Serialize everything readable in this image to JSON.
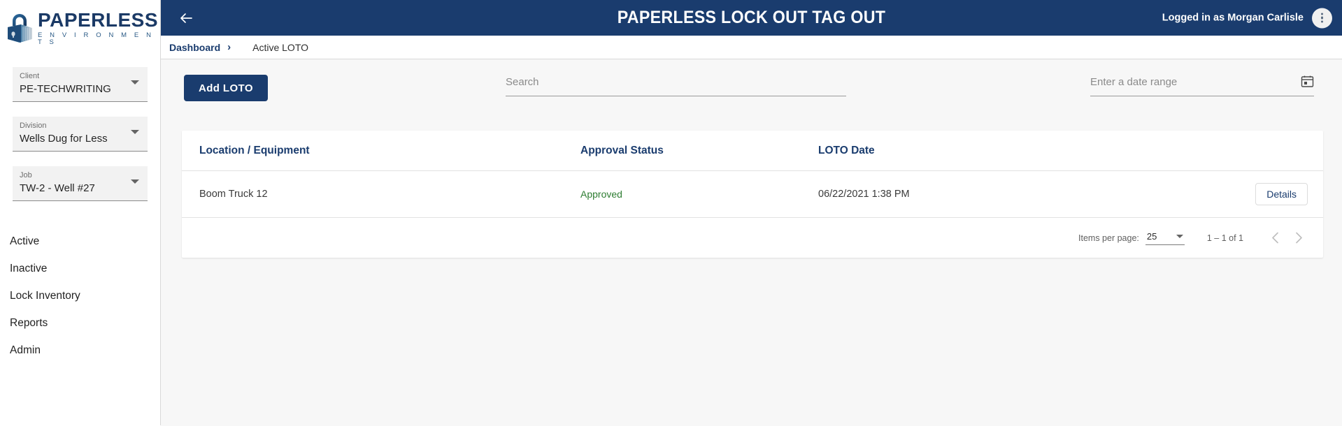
{
  "brand": {
    "logo_icon": "padlock-icon",
    "name": "PAPERLESS",
    "tagline": "E N V I R O N M E N T S",
    "navy": "#1a3c6e"
  },
  "header": {
    "back_icon": "arrow-left-icon",
    "title": "PAPERLESS LOCK OUT TAG OUT",
    "logged_in": "Logged in as Morgan Carlisle",
    "menu_icon": "more-vertical-icon"
  },
  "breadcrumb": {
    "root": "Dashboard",
    "separator": "›",
    "current": "Active LOTO"
  },
  "sidebar": {
    "selects": [
      {
        "label": "Client",
        "value": "PE-TECHWRITING",
        "icon": "chevron-down-icon"
      },
      {
        "label": "Division",
        "value": "Wells Dug for Less",
        "icon": "chevron-down-icon"
      },
      {
        "label": "Job",
        "value": "TW-2 - Well #27",
        "icon": "chevron-down-icon"
      }
    ],
    "nav": [
      {
        "label": "Active"
      },
      {
        "label": "Inactive"
      },
      {
        "label": "Lock Inventory"
      },
      {
        "label": "Reports"
      },
      {
        "label": "Admin"
      }
    ]
  },
  "toolbar": {
    "add_label": "Add LOTO",
    "search": {
      "value": "",
      "placeholder": "Search",
      "icon": "search-field"
    },
    "date_range": {
      "value": "",
      "placeholder": "Enter a date range",
      "icon": "calendar-icon"
    }
  },
  "table": {
    "columns": [
      "Location / Equipment",
      "Approval Status",
      "LOTO Date",
      ""
    ],
    "rows": [
      {
        "location": "Boom Truck 12",
        "status": "Approved",
        "status_color": "#2e7d32",
        "date": "06/22/2021 1:38 PM",
        "action": "Details"
      }
    ]
  },
  "paginator": {
    "items_per_page_label": "Items per page:",
    "items_per_page_value": "25",
    "range": "1 – 1 of 1",
    "prev_icon": "chevron-left-icon",
    "next_icon": "chevron-right-icon"
  }
}
